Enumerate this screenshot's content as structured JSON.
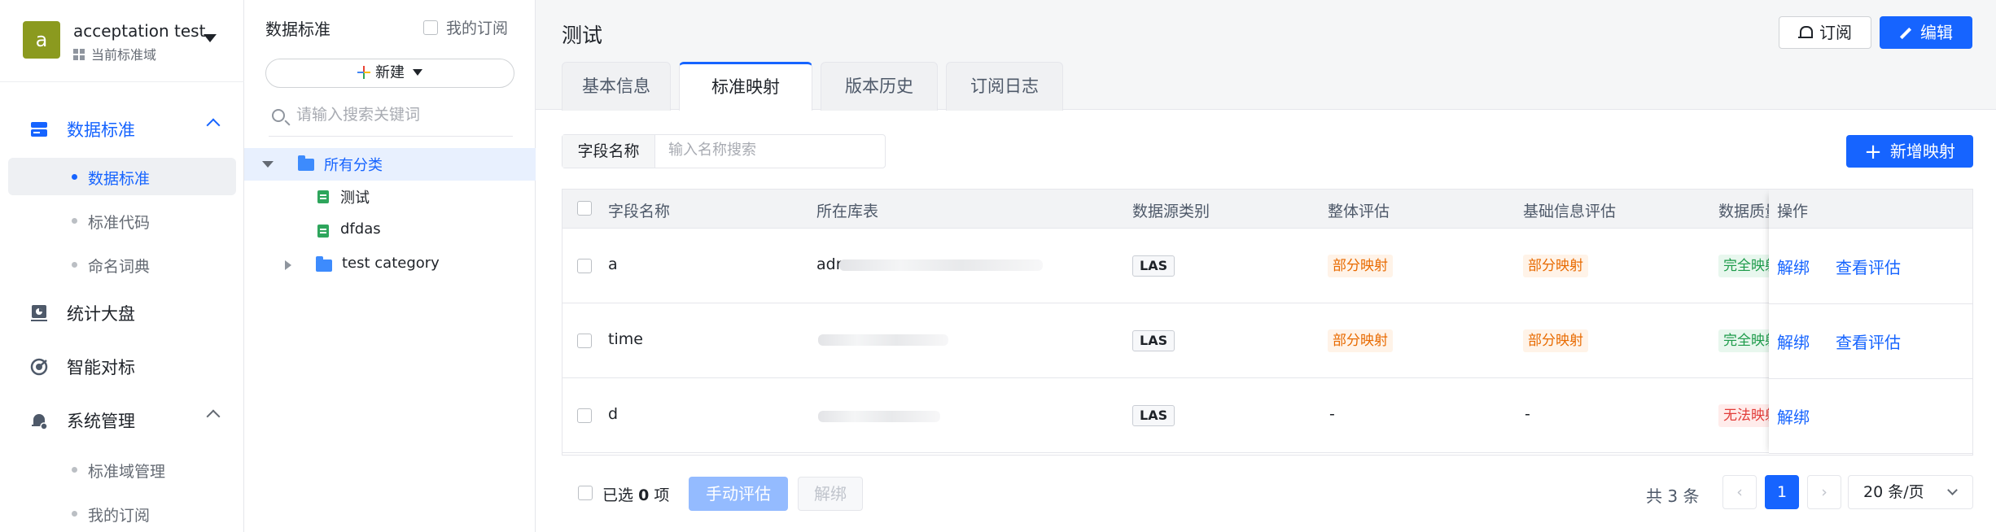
{
  "workspace": {
    "avatar": "a",
    "name": "acceptation test",
    "subtitle": "当前标准域"
  },
  "nav": {
    "group_data_standard": "数据标准",
    "sub_items": [
      "数据标准",
      "标准代码",
      "命名词典"
    ],
    "group_stats": "统计大盘",
    "group_smart": "智能对标",
    "group_system": "系统管理",
    "system_items": [
      "标准域管理",
      "我的订阅"
    ]
  },
  "tree": {
    "title": "数据标准",
    "my_subscription": "我的订阅",
    "new_button": "新建",
    "search_placeholder": "请输入搜索关键词",
    "root": "所有分类",
    "children": [
      "测试",
      "dfdas"
    ],
    "folder": "test category"
  },
  "main": {
    "title": "测试",
    "subscribe_button": "订阅",
    "edit_button": "编辑",
    "tabs": [
      "基本信息",
      "标准映射",
      "版本历史",
      "订阅日志"
    ],
    "filter_label": "字段名称",
    "filter_placeholder": "输入名称搜索",
    "add_mapping_button": "新增映射"
  },
  "table": {
    "columns": [
      "字段名称",
      "所在库表",
      "数据源类别",
      "整体评估",
      "基础信息评估",
      "数据质量",
      "操作"
    ],
    "rows": [
      {
        "field": "a",
        "table_prefix": "adr",
        "source": "LAS",
        "overall": "部分映射",
        "basic": "部分映射",
        "quality": "完全映射",
        "ops": [
          "解绑",
          "查看评估"
        ]
      },
      {
        "field": "time",
        "table_prefix": "",
        "source": "LAS",
        "overall": "部分映射",
        "basic": "部分映射",
        "quality": "完全映射",
        "ops": [
          "解绑",
          "查看评估"
        ]
      },
      {
        "field": "d",
        "table_prefix": "",
        "source": "LAS",
        "overall": "-",
        "basic": "-",
        "quality": "无法映射",
        "ops": [
          "解绑"
        ]
      }
    ]
  },
  "footer": {
    "selected_prefix": "已选",
    "selected_count": "0",
    "selected_suffix": "项",
    "manual_eval_button": "手动评估",
    "unbind_button": "解绑",
    "total": "共 3 条",
    "current_page": "1",
    "page_size": "20 条/页"
  },
  "colors": {
    "primary": "#1664ff",
    "partial": "#e86a00",
    "full": "#1d9b4a",
    "none": "#e23c39"
  }
}
